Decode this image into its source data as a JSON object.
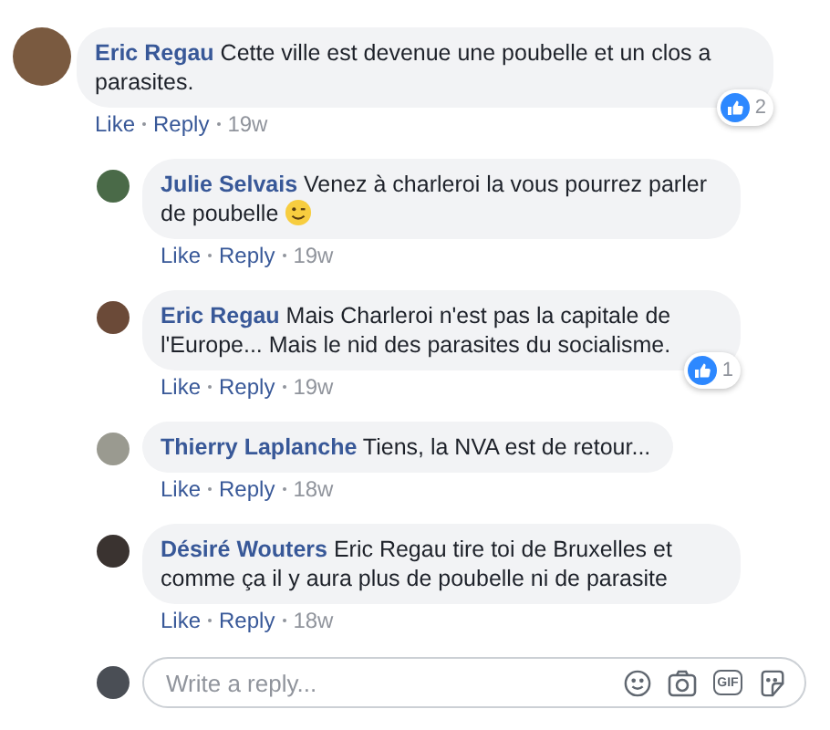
{
  "comments": [
    {
      "author": "Eric Regau",
      "text": "Cette ville est devenue une poubelle et un clos a parasites.",
      "like": "Like",
      "reply": "Reply",
      "time": "19w",
      "reactions": {
        "count": "2"
      },
      "replies": [
        {
          "author": "Julie Selvais",
          "text": "Venez à charleroi la vous pourrez parler de poubelle",
          "emoji": {
            "kind": "wink"
          },
          "like": "Like",
          "reply": "Reply",
          "time": "19w"
        },
        {
          "author": "Eric Regau",
          "text": "Mais Charleroi n'est pas la capitale de l'Europe... Mais le nid des parasites du socialisme.",
          "like": "Like",
          "reply": "Reply",
          "time": "19w",
          "reactions": {
            "count": "1"
          }
        },
        {
          "author": "Thierry Laplanche",
          "text": "Tiens, la NVA est de retour...",
          "like": "Like",
          "reply": "Reply",
          "time": "18w"
        },
        {
          "author": "Désiré Wouters",
          "text": "Eric Regau tire toi de Bruxelles et comme ça il y aura plus de poubelle ni de parasite",
          "like": "Like",
          "reply": "Reply",
          "time": "18w"
        }
      ]
    }
  ],
  "reply_box": {
    "placeholder": "Write a reply...",
    "gif_label": "GIF"
  }
}
